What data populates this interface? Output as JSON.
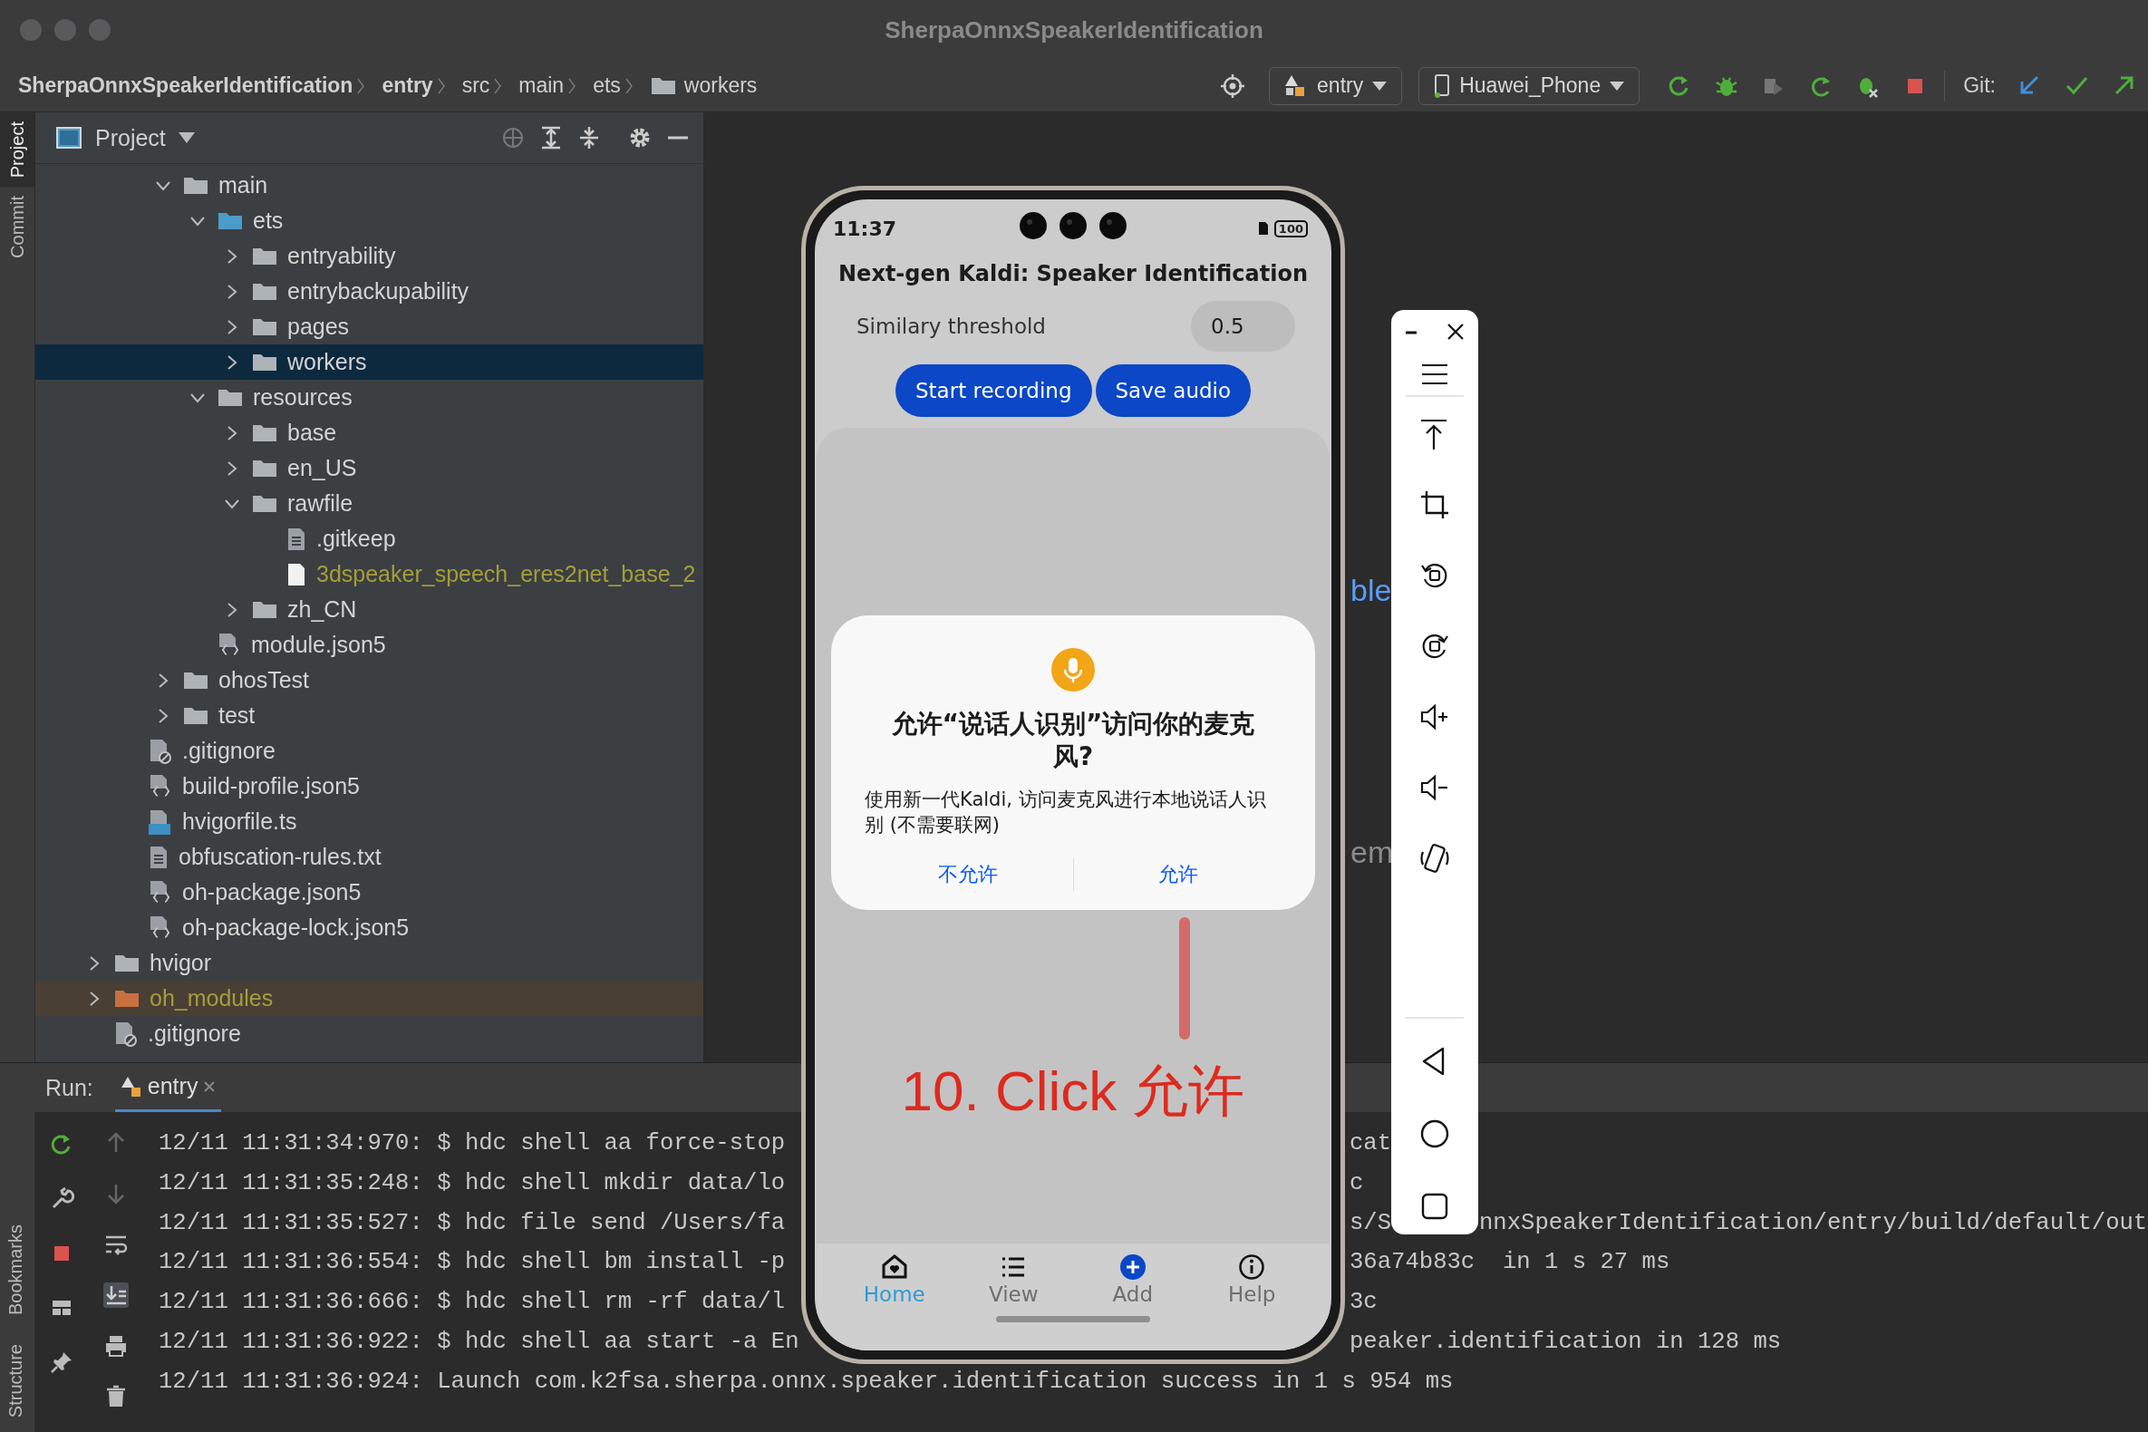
{
  "window": {
    "title": "SherpaOnnxSpeakerIdentification"
  },
  "breadcrumbs": [
    {
      "label": "SherpaOnnxSpeakerIdentification",
      "kind": "project"
    },
    {
      "label": "entry",
      "kind": "module"
    },
    {
      "label": "src",
      "kind": "directory"
    },
    {
      "label": "main",
      "kind": "directory"
    },
    {
      "label": "ets",
      "kind": "directory"
    },
    {
      "label": "workers",
      "kind": "current"
    }
  ],
  "run_config": {
    "label": "entry"
  },
  "device": {
    "label": "Huawei_Phone"
  },
  "git_label": "Git:",
  "left_strip": {
    "top": [
      {
        "label": "Project",
        "selected": true
      },
      {
        "label": "Commit",
        "selected": false
      }
    ],
    "bottom": [
      {
        "label": "Bookmarks",
        "selected": false
      },
      {
        "label": "Structure",
        "selected": false
      }
    ]
  },
  "project_panel": {
    "title": "Project",
    "tree": {
      "children": [
        {
          "children": [
            {
              "children": [
                {
                  "label": "main",
                  "kind": "folder",
                  "expanded": true,
                  "selected": false,
                  "children": [
                    {
                      "label": "ets",
                      "kind": "source-folder",
                      "expanded": true,
                      "selected": false,
                      "children": [
                        {
                          "label": "entryability",
                          "kind": "folder",
                          "expanded": false,
                          "selected": false
                        },
                        {
                          "label": "entrybackupability",
                          "kind": "folder",
                          "expanded": false,
                          "selected": false
                        },
                        {
                          "label": "pages",
                          "kind": "folder",
                          "expanded": false,
                          "selected": false
                        },
                        {
                          "label": "workers",
                          "kind": "folder",
                          "expanded": false,
                          "selected": true
                        }
                      ]
                    },
                    {
                      "label": "resources",
                      "kind": "folder",
                      "expanded": true,
                      "selected": false,
                      "children": [
                        {
                          "label": "base",
                          "kind": "folder",
                          "expanded": false,
                          "selected": false
                        },
                        {
                          "label": "en_US",
                          "kind": "folder",
                          "expanded": false,
                          "selected": false
                        },
                        {
                          "label": "rawfile",
                          "kind": "folder",
                          "expanded": true,
                          "selected": false,
                          "children": [
                            {
                              "label": ".gitkeep",
                              "kind": "text-file",
                              "selected": false
                            },
                            {
                              "label": "3dspeaker_speech_eres2net_base_2",
                              "kind": "binary-file",
                              "selected": false,
                              "color": "#a39e3a"
                            }
                          ]
                        },
                        {
                          "label": "zh_CN",
                          "kind": "folder",
                          "expanded": false,
                          "selected": false
                        }
                      ]
                    },
                    {
                      "label": "module.json5",
                      "kind": "json-file",
                      "selected": false
                    }
                  ]
                },
                {
                  "label": "ohosTest",
                  "kind": "folder",
                  "expanded": false,
                  "selected": false
                },
                {
                  "label": "test",
                  "kind": "folder",
                  "expanded": false,
                  "selected": false
                }
              ]
            },
            {
              "label": ".gitignore",
              "kind": "ignore-file",
              "selected": false
            },
            {
              "label": "build-profile.json5",
              "kind": "json-file",
              "selected": false
            },
            {
              "label": "hvigorfile.ts",
              "kind": "ts-file",
              "selected": false
            },
            {
              "label": "obfuscation-rules.txt",
              "kind": "text-file",
              "selected": false
            },
            {
              "label": "oh-package.json5",
              "kind": "json-file",
              "selected": false
            },
            {
              "label": "oh-package-lock.json5",
              "kind": "json-file",
              "selected": false
            }
          ]
        },
        {
          "label": "hvigor",
          "kind": "folder",
          "expanded": false,
          "selected": false
        },
        {
          "label": "oh_modules",
          "kind": "excluded-folder",
          "expanded": false,
          "selected": false,
          "color": "#a39e3a"
        },
        {
          "label": ".gitignore",
          "kind": "ignore-file",
          "selected": false
        }
      ]
    }
  },
  "editor": {
    "fragments": [
      {
        "text": "ble",
        "kind": "link"
      },
      {
        "text": "em",
        "kind": "plain"
      }
    ]
  },
  "run_panel": {
    "label": "Run:",
    "tab": {
      "label": "entry",
      "selected": true
    },
    "lines": [
      {
        "start": "12/11 11:31:34:970: $ hdc shell aa force-stop",
        "after_phone": "cat"
      },
      {
        "start": "12/11 11:31:35:248: $ hdc shell mkdir data/lo",
        "after_phone": "c"
      },
      {
        "start": "12/11 11:31:35:527: $ hdc file send /Users/fa",
        "after_phone": "s/S",
        "after_toolbar": "nnxSpeakerIdentification/entry/build/default/out"
      },
      {
        "start": "12/11 11:31:36:554: $ hdc shell bm install -p",
        "after_phone": "36a74b83c  in 1 s 27 ms"
      },
      {
        "start": "12/11 11:31:36:666: $ hdc shell rm -rf data/l",
        "after_phone": "3c"
      },
      {
        "start": "12/11 11:31:36:922: $ hdc shell aa start -a En",
        "after_phone": "peaker.identification in 128 ms"
      },
      {
        "start": "12/11 11:31:36:924: Launch com.k2fsa.sherpa.onnx.speaker.identification success in 1 s 954 ms"
      }
    ]
  },
  "emulator": {
    "status_time": "11:37",
    "battery": "100",
    "app_title": "Next-gen Kaldi: Speaker Identification",
    "threshold_label": "Similary threshold",
    "threshold_value": "0.5",
    "buttons": [
      "Start recording",
      "Save audio"
    ],
    "dialog": {
      "title": "允许“说话人识别”访问你的麦克风?",
      "message": "使用新一代Kaldi, 访问麦克风进行本地说话人识别 (不需要联网)",
      "buttons": [
        "不允许",
        "允许"
      ]
    },
    "annotation": "10. Click 允许",
    "nav": [
      {
        "label": "Home",
        "selected": true
      },
      {
        "label": "View",
        "selected": false
      },
      {
        "label": "Add",
        "selected": false
      },
      {
        "label": "Help",
        "selected": false
      }
    ]
  }
}
